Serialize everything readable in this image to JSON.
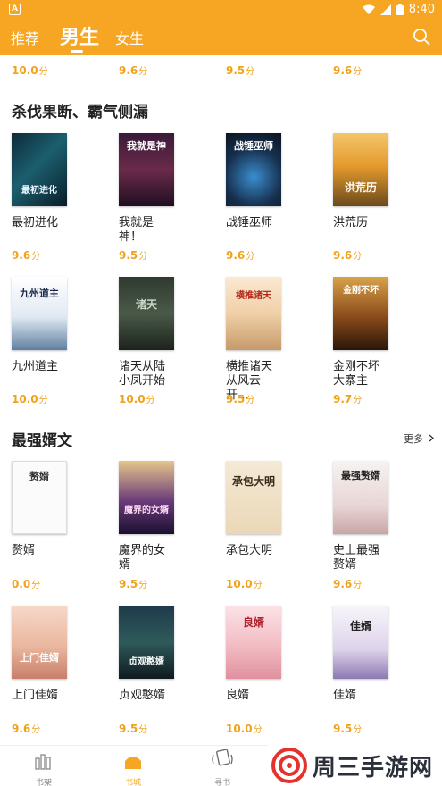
{
  "status": {
    "time": "8:40"
  },
  "header": {
    "tabs": [
      {
        "label": "推荐"
      },
      {
        "label": "男生"
      },
      {
        "label": "女生"
      }
    ]
  },
  "top_scores": [
    {
      "score": "10.0",
      "unit": "分"
    },
    {
      "score": "9.6",
      "unit": "分"
    },
    {
      "score": "9.5",
      "unit": "分"
    },
    {
      "score": "9.6",
      "unit": "分"
    }
  ],
  "section1": {
    "title": "杀伐果断、霸气侧漏",
    "books": [
      {
        "title": "最初进化",
        "cover_text": "最初进化",
        "score": "9.6",
        "unit": "分"
      },
      {
        "title": "我就是神！",
        "cover_text": "我就是神",
        "score": "9.5",
        "unit": "分"
      },
      {
        "title": "战锤巫师",
        "cover_text": "战锤巫师",
        "score": "9.6",
        "unit": "分"
      },
      {
        "title": "洪荒历",
        "cover_text": "洪荒历",
        "score": "9.6",
        "unit": "分"
      },
      {
        "title": "九州道主",
        "cover_text": "九州道主",
        "score": "10.0",
        "unit": "分"
      },
      {
        "title": "诸天从陆小凤开始",
        "cover_text": "诸天",
        "score": "10.0",
        "unit": "分"
      },
      {
        "title": "横推诸天从风云开…",
        "cover_text": "横推诸天",
        "score": "9.5",
        "unit": "分"
      },
      {
        "title": "金刚不坏大寨主",
        "cover_text": "金刚不坏",
        "score": "9.7",
        "unit": "分"
      }
    ]
  },
  "section2": {
    "title": "最强婿文",
    "more_label": "更多",
    "books": [
      {
        "title": "赘婿",
        "cover_text": "赘婿",
        "score": "0.0",
        "unit": "分"
      },
      {
        "title": "魔界的女婿",
        "cover_text": "魔界的女婿",
        "score": "9.5",
        "unit": "分"
      },
      {
        "title": "承包大明",
        "cover_text": "承包大明",
        "score": "10.0",
        "unit": "分"
      },
      {
        "title": "史上最强赘婿",
        "cover_text": "最强赘婿",
        "score": "9.6",
        "unit": "分"
      },
      {
        "title": "上门佳婿",
        "cover_text": "上门佳婿",
        "score": "9.6",
        "unit": "分"
      },
      {
        "title": "贞观憨婿",
        "cover_text": "贞观憨婿",
        "score": "9.5",
        "unit": "分"
      },
      {
        "title": "良婿",
        "cover_text": "良婿",
        "score": "10.0",
        "unit": "分"
      },
      {
        "title": "佳婿",
        "cover_text": "佳婿",
        "score": "9.5",
        "unit": "分"
      }
    ]
  },
  "nav": {
    "items": [
      {
        "label": "书架"
      },
      {
        "label": "书城"
      },
      {
        "label": "寻书"
      }
    ]
  },
  "watermark": {
    "text": "周三手游网"
  },
  "colors": {
    "accent": "#f6a623",
    "score": "#f0a21c"
  }
}
